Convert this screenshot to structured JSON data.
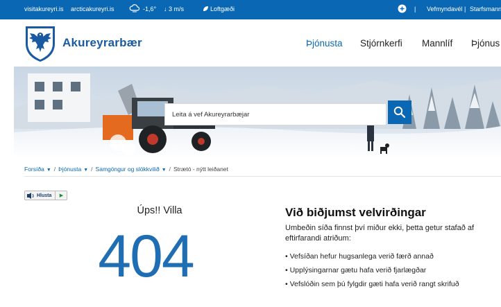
{
  "topbar": {
    "links": [
      "visitakureyri.is",
      "arcticakureyri.is"
    ],
    "weather_icon": "cloud-icon",
    "temperature": "-1,6°",
    "wind": "↓ 3 m/s",
    "air_quality_icon": "leaf-icon",
    "air_quality": "Loftgæði",
    "add_icon": "plus-circle-icon",
    "separator": "|",
    "accessibility": "Vefmyndavél",
    "staff": "Starfsmannavef"
  },
  "header": {
    "brand": "Akureyrarbær",
    "nav": [
      "Þjónusta",
      "Stjórnkerfi",
      "Mannlíf",
      "Þjónus"
    ],
    "active_color": "#0a67b3"
  },
  "search": {
    "placeholder": "Leita á vef Akureyrarbæjar",
    "icon": "search-icon"
  },
  "breadcrumb": {
    "items": [
      "Forsíða",
      "Þjónusta",
      "Samgöngur og slökkvilið",
      "Strætó - nýtt leiðanet"
    ],
    "separator": "/"
  },
  "listen": {
    "label": "Hlusta",
    "icon": "speaker-icon",
    "play_icon": "play-icon"
  },
  "error": {
    "title": "Úps!! Villa",
    "code": "404",
    "code_color": "#1f6db3"
  },
  "apology": {
    "title": "Við biðjumst velvirðingar",
    "text": "Umbeðin síða finnst því miður ekki, þetta getur stafað af eftirfarandi atriðum:",
    "reasons": [
      "• Vefsíðan hefur hugsanlega verið færð annað",
      "• Upplýsingarnar gætu hafa verið fjarlægðar",
      "• Vefslóðin sem þú fylgdir gæti hafa verið rangt skrifuð"
    ]
  },
  "colors": {
    "brand_blue": "#0a67b3"
  }
}
